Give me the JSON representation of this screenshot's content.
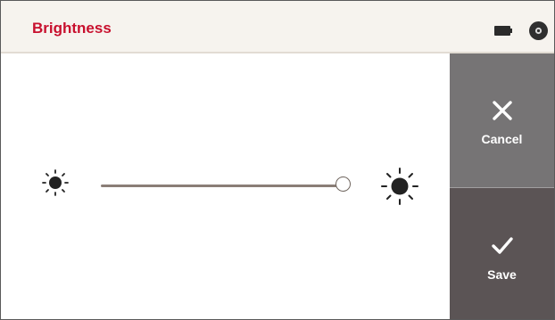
{
  "header": {
    "title": "Brightness",
    "title_color": "#c8102e",
    "icons": [
      "battery-icon",
      "disc-icon"
    ]
  },
  "brightness": {
    "level_percent": 100,
    "min_icon": "sun-small-icon",
    "max_icon": "sun-large-icon"
  },
  "actions": {
    "cancel_label": "Cancel",
    "cancel_icon": "close-icon",
    "save_label": "Save",
    "save_icon": "checkmark-icon"
  },
  "colors": {
    "header_bg": "#f6f3ee",
    "cancel_bg": "#767475",
    "save_bg": "#5b5455",
    "slider_track": "#8a7e76"
  }
}
